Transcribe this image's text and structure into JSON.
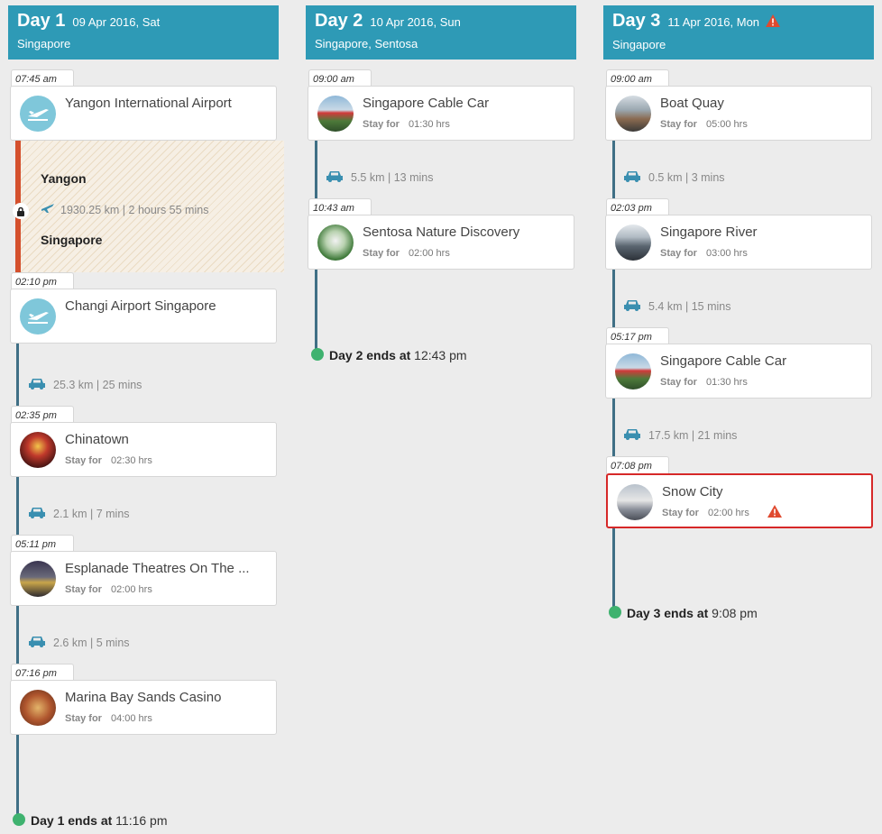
{
  "colors": {
    "header": "#2e9ab6",
    "timeline": "#3f6f85",
    "flight_bar": "#d4502d",
    "end_dot": "#3fb26f",
    "warning": "#d62828",
    "car_icon": "#3a8fb0"
  },
  "days": [
    {
      "title": "Day 1",
      "date": "09 Apr 2016, Sat",
      "city": "Singapore",
      "end_label": "Day 1 ends at",
      "end_time": "11:16 pm",
      "stops": [
        {
          "time": "07:45 am",
          "name": "Yangon International Airport",
          "icon": "airplane-icon"
        },
        {
          "time": "02:10 pm",
          "name": "Changi Airport Singapore",
          "icon": "airplane-icon"
        },
        {
          "time": "02:35 pm",
          "name": "Chinatown",
          "stay_label": "Stay for",
          "stay": "02:30 hrs"
        },
        {
          "time": "05:11 pm",
          "name": "Esplanade Theatres On The ...",
          "stay_label": "Stay for",
          "stay": "02:00 hrs"
        },
        {
          "time": "07:16 pm",
          "name": "Marina Bay Sands Casino",
          "stay_label": "Stay for",
          "stay": "04:00 hrs"
        }
      ],
      "flight": {
        "from": "Yangon",
        "to": "Singapore",
        "info": "1930.25 km | 2 hours 55 mins"
      },
      "transports": [
        "25.3 km | 25 mins",
        "2.1 km | 7 mins",
        "2.6 km | 5 mins"
      ]
    },
    {
      "title": "Day 2",
      "date": "10 Apr 2016, Sun",
      "city": "Singapore, Sentosa",
      "end_label": "Day 2 ends at",
      "end_time": "12:43 pm",
      "stops": [
        {
          "time": "09:00 am",
          "name": "Singapore Cable Car",
          "stay_label": "Stay for",
          "stay": "01:30 hrs"
        },
        {
          "time": "10:43 am",
          "name": "Sentosa Nature Discovery",
          "stay_label": "Stay for",
          "stay": "02:00 hrs"
        }
      ],
      "transports": [
        "5.5 km | 13 mins"
      ]
    },
    {
      "title": "Day 3",
      "date": "11 Apr 2016, Mon",
      "city": "Singapore",
      "warning": true,
      "end_label": "Day 3 ends at",
      "end_time": "9:08 pm",
      "stops": [
        {
          "time": "09:00 am",
          "name": "Boat Quay",
          "stay_label": "Stay for",
          "stay": "05:00 hrs"
        },
        {
          "time": "02:03 pm",
          "name": "Singapore River",
          "stay_label": "Stay for",
          "stay": "03:00 hrs"
        },
        {
          "time": "05:17 pm",
          "name": "Singapore Cable Car",
          "stay_label": "Stay for",
          "stay": "01:30 hrs"
        },
        {
          "time": "07:08 pm",
          "name": "Snow City",
          "stay_label": "Stay for",
          "stay": "02:00 hrs",
          "warning": true
        }
      ],
      "transports": [
        "0.5 km | 3 mins",
        "5.4 km | 15 mins",
        "17.5 km | 21 mins"
      ]
    }
  ]
}
